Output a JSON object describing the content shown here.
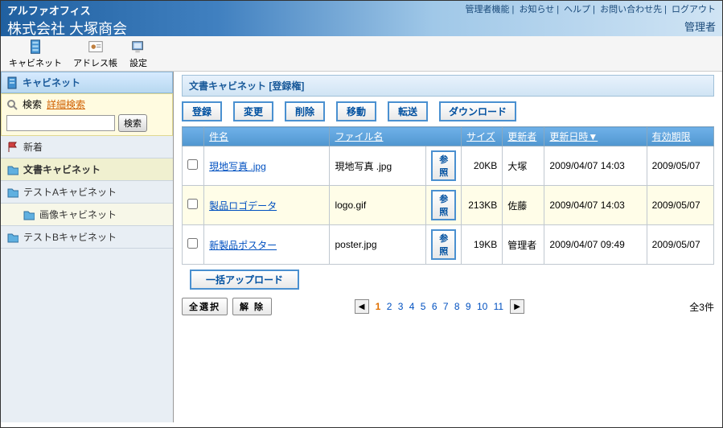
{
  "header": {
    "appName": "アルファオフィス",
    "company": "株式会社 大塚商会",
    "links": [
      "管理者機能",
      "お知らせ",
      "ヘルプ",
      "お問い合わせ先",
      "ログアウト"
    ],
    "role": "管理者"
  },
  "toolbar": {
    "cabinet": "キャビネット",
    "address": "アドレス帳",
    "settings": "設定"
  },
  "sidebar": {
    "title": "キャビネット",
    "search": "検索",
    "advanced": "詳細検索",
    "searchBtn": "検索",
    "nav": {
      "new": "新着",
      "doc": "文書キャビネット",
      "testA": "テストAキャビネット",
      "image": "画像キャビネット",
      "testB": "テストBキャビネット"
    }
  },
  "panel": {
    "title": "文書キャビネット [登録権]",
    "actions": {
      "register": "登録",
      "change": "変更",
      "delete": "削除",
      "move": "移動",
      "forward": "転送",
      "download": "ダウンロード"
    },
    "columns": {
      "name": "件名",
      "file": "ファイル名",
      "ref": "参照",
      "size": "サイズ",
      "updater": "更新者",
      "updated": "更新日時▼",
      "expires": "有効期限"
    },
    "rows": [
      {
        "name": "現地写真 .jpg",
        "file": "現地写真 .jpg",
        "size": "20KB",
        "updater": "大塚",
        "updated": "2009/04/07 14:03",
        "expires": "2009/05/07"
      },
      {
        "name": "製品ロゴデータ",
        "file": "logo.gif",
        "size": "213KB",
        "updater": "佐藤",
        "updated": "2009/04/07 14:03",
        "expires": "2009/05/07"
      },
      {
        "name": "新製品ポスター",
        "file": "poster.jpg",
        "size": "19KB",
        "updater": "管理者",
        "updated": "2009/04/07 09:49",
        "expires": "2009/05/07"
      }
    ],
    "batchUpload": "一括アップロード",
    "selectAll": "全選択",
    "clear": "解 除",
    "pages": [
      "1",
      "2",
      "3",
      "4",
      "5",
      "6",
      "7",
      "8",
      "9",
      "10",
      "11"
    ],
    "total": "全3件"
  }
}
